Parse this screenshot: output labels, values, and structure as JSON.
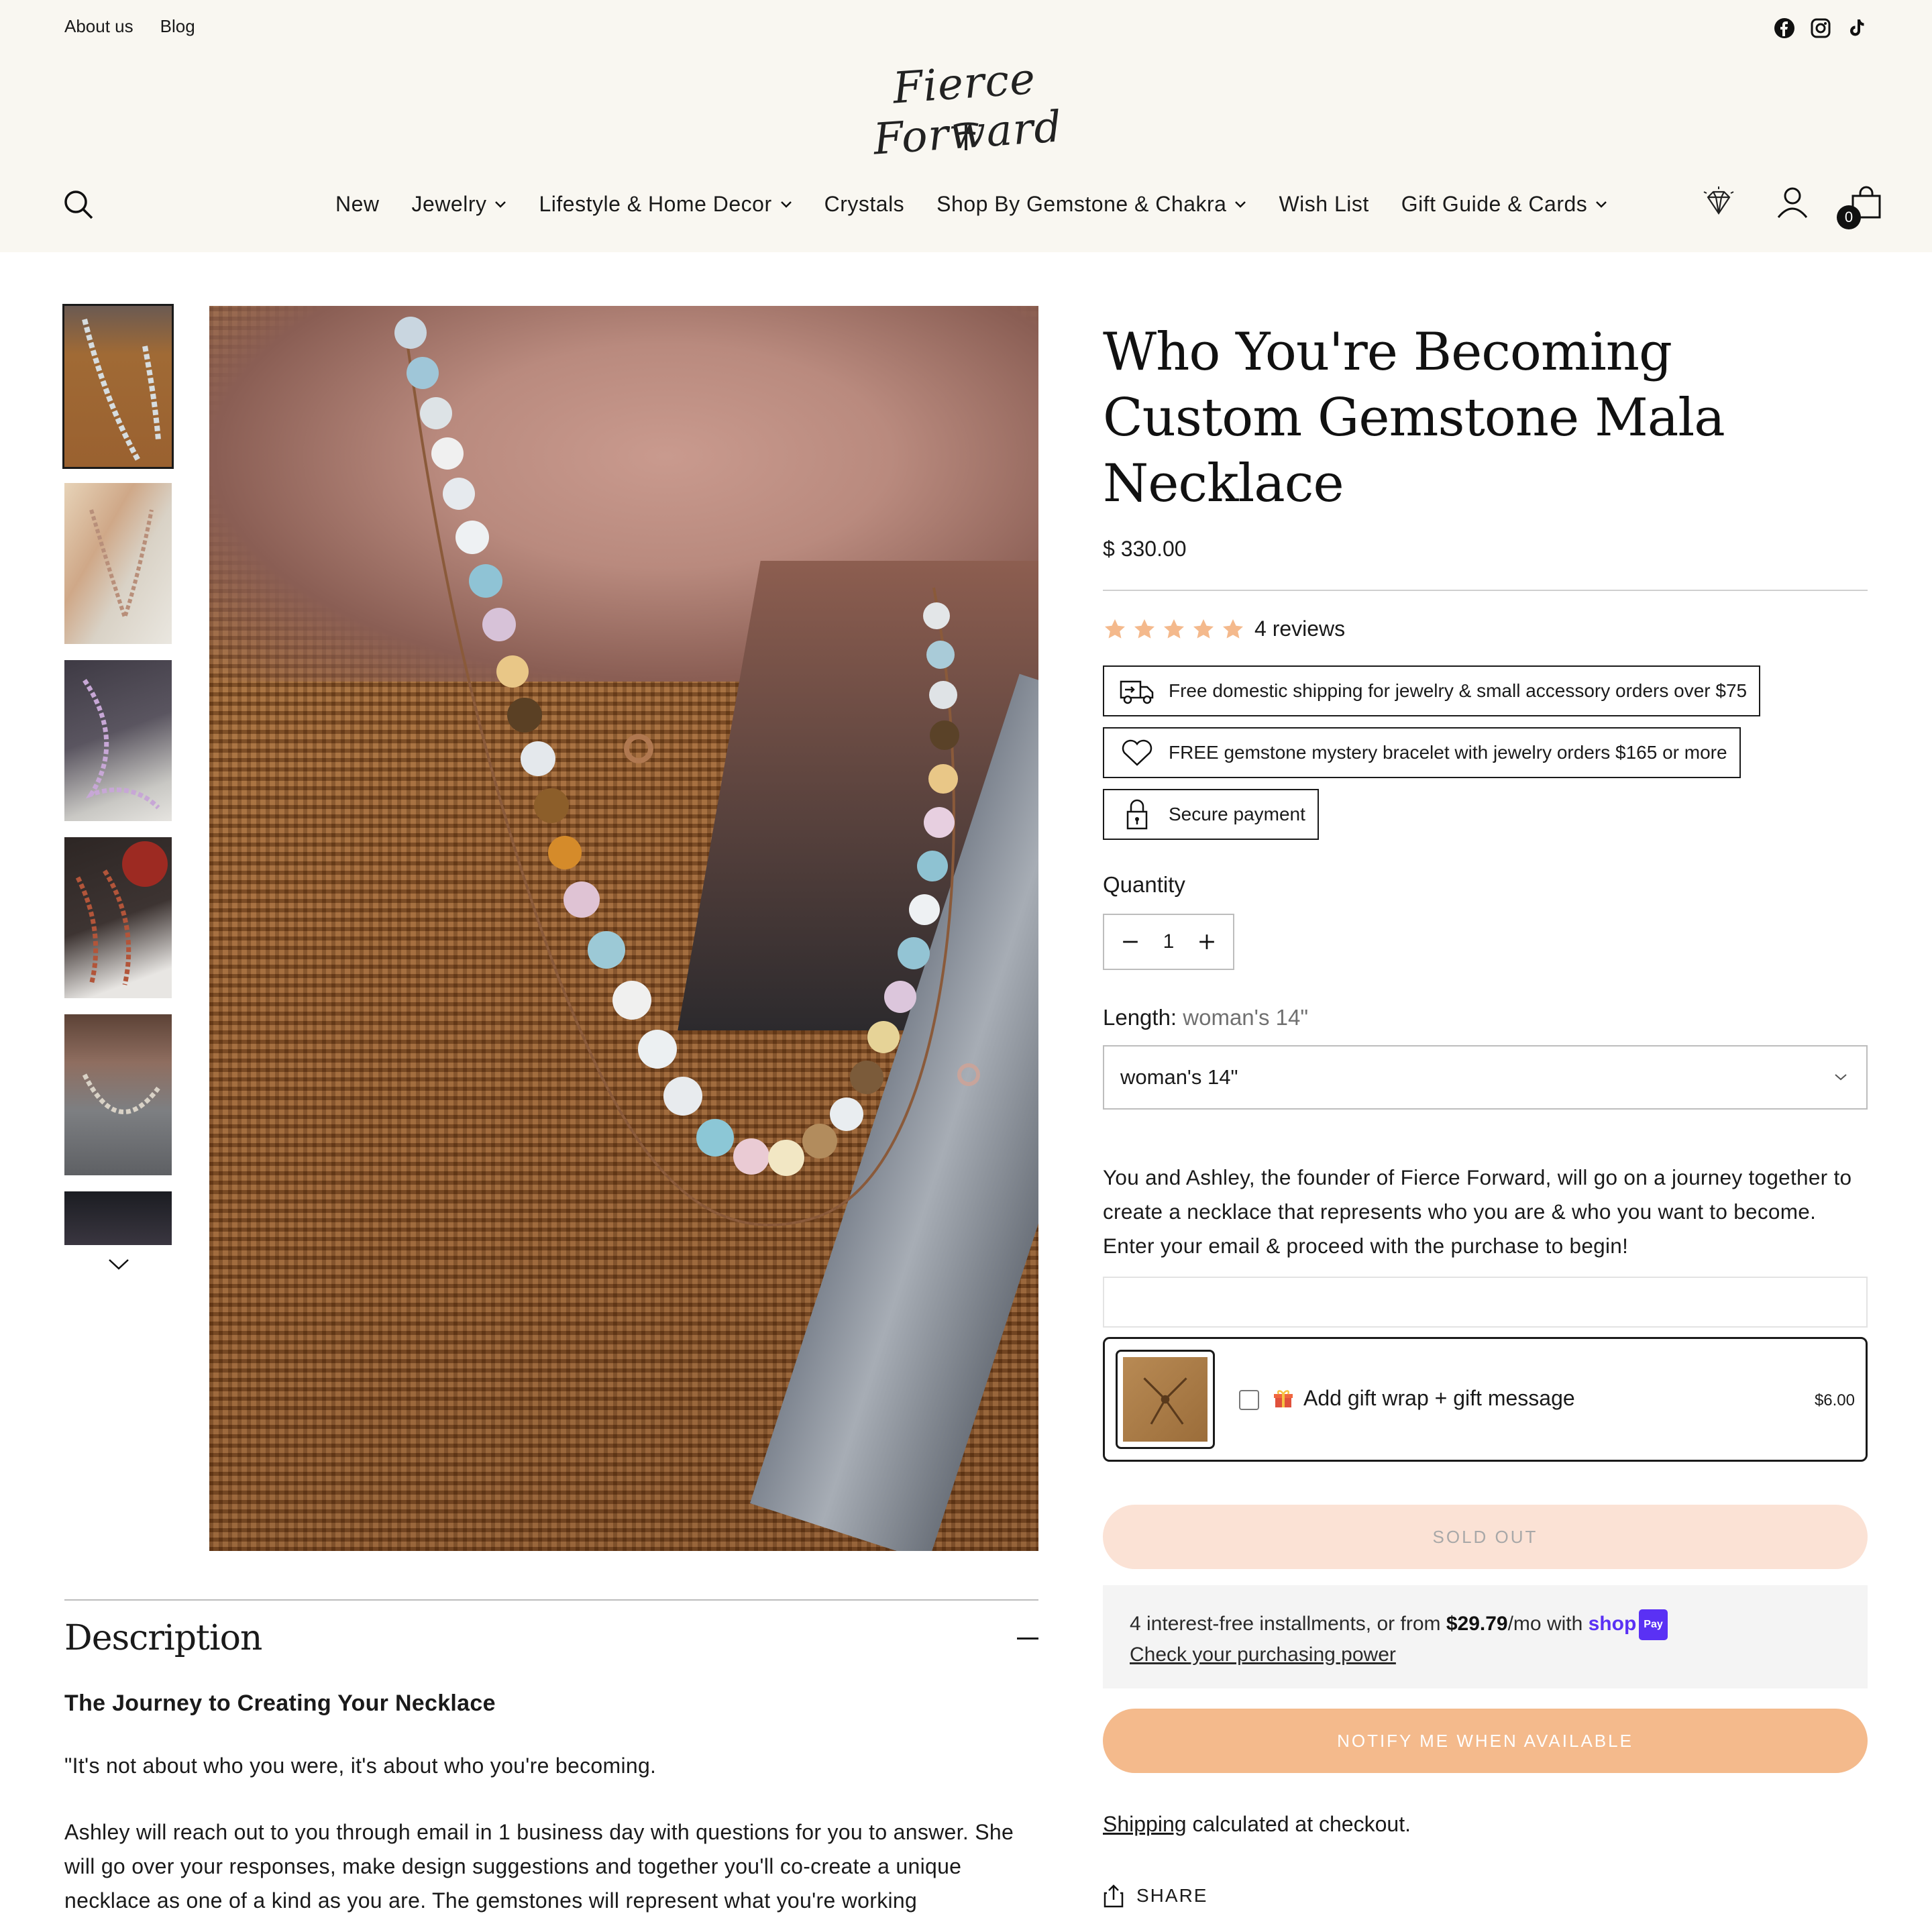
{
  "header": {
    "util_links": [
      "About us",
      "Blog"
    ],
    "logo_text": "Fierce Forward",
    "nav": [
      {
        "label": "New",
        "dropdown": false
      },
      {
        "label": "Jewelry",
        "dropdown": true
      },
      {
        "label": "Lifestyle & Home Decor",
        "dropdown": true
      },
      {
        "label": "Crystals",
        "dropdown": false
      },
      {
        "label": "Shop By Gemstone & Chakra",
        "dropdown": true
      },
      {
        "label": "Wish List",
        "dropdown": false
      },
      {
        "label": "Gift Guide & Cards",
        "dropdown": true
      }
    ],
    "cart_count": "0",
    "socials": [
      "facebook-icon",
      "instagram-icon",
      "tiktok-icon"
    ]
  },
  "product": {
    "title": "Who You're Becoming Custom Gemstone Mala Necklace",
    "price": "$ 330.00",
    "rating_stars": 5,
    "reviews": "4 reviews",
    "perks": [
      {
        "icon": "truck-icon",
        "text": "Free domestic shipping for jewelry & small accessory orders over $75"
      },
      {
        "icon": "heart-icon",
        "text": "FREE gemstone mystery bracelet with jewelry orders $165 or more"
      },
      {
        "icon": "lock-icon",
        "text": "Secure payment"
      }
    ],
    "quantity_label": "Quantity",
    "quantity_value": "1",
    "length_label": "Length:",
    "length_value": "woman's 14\"",
    "length_selected": "woman's 14\"",
    "intro": "You and Ashley, the founder of Fierce Forward, will go on a journey together to create a necklace that represents who you are & who you want to become. Enter your email & proceed with the purchase to begin!",
    "gift_wrap_label": "Add gift wrap + gift message",
    "gift_wrap_price": "$6.00",
    "sold_out_label": "SOLD OUT",
    "installments_prefix": "4 interest-free installments, or from ",
    "installments_amount": "$29.79",
    "installments_suffix": "/mo with ",
    "shop_pay_brand": "shop",
    "shop_pay_badge": "Pay",
    "purchasing_power_link": "Check your purchasing power",
    "notify_label": "NOTIFY ME WHEN AVAILABLE",
    "shipping_link": "Shipping",
    "shipping_text": " calculated at checkout.",
    "share_label": "SHARE"
  },
  "description": {
    "heading": "Description",
    "subheading": "The Journey to Creating Your Necklace",
    "quote": "\"It's not about who you were, it's about who you're becoming.",
    "body": "Ashley will reach out to you through email in 1 business day with questions for you to answer. She will go over your responses, make design suggestions and together you'll co-create a unique necklace as one of a kind as you are. The gemstones will represent what you're working"
  },
  "colors": {
    "header_bg": "#f9f7f1",
    "star": "#f4b98c",
    "sold_out_bg": "#fbe2d5",
    "notify_bg": "#f4ba8c",
    "shop_pay": "#5a31f4"
  }
}
